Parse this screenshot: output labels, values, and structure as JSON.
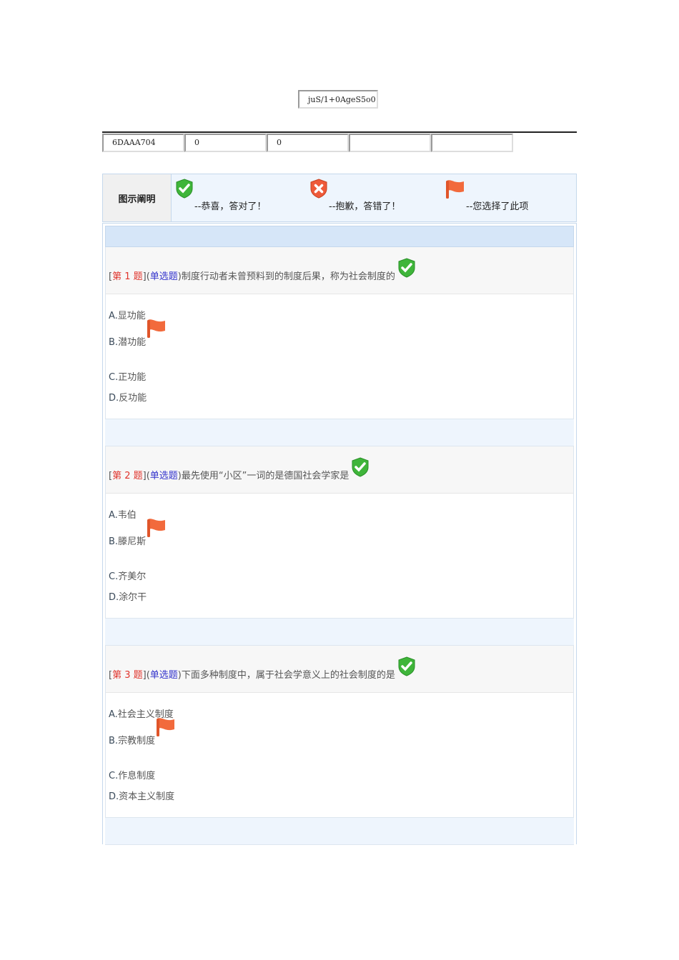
{
  "header": {
    "code": "juS/1+0AgeS5o0",
    "cells": [
      "6DAAA704",
      "0",
      "0",
      "",
      ""
    ]
  },
  "legend": {
    "title": "图示阐明",
    "items": [
      {
        "icon": "check-icon",
        "label": "--恭喜，答对了！"
      },
      {
        "icon": "cross-icon",
        "label": "--抱歉，答错了！"
      },
      {
        "icon": "flag-icon",
        "label": "--您选择了此项"
      }
    ]
  },
  "questions": [
    {
      "no_prefix": "[",
      "no": "第 1 题",
      "no_suffix": "](",
      "type": "单选题",
      "type_suffix": ")",
      "text": " 制度行动者未曾预料到的制度后果，称为社会制度的",
      "result": "correct",
      "selected": 1,
      "options": [
        {
          "letter": "A.",
          "text": "显功能"
        },
        {
          "letter": "B.",
          "text": "潜功能"
        },
        {
          "letter": "C.",
          "text": "正功能"
        },
        {
          "letter": "D.",
          "text": "反功能"
        }
      ]
    },
    {
      "no_prefix": "[",
      "no": "第 2 题",
      "no_suffix": "](",
      "type": "单选题",
      "type_suffix": ")",
      "text": "最先使用“小区”一词的是德国社会学家是",
      "result": "correct",
      "selected": 1,
      "options": [
        {
          "letter": "A.",
          "text": "韦伯"
        },
        {
          "letter": "B.",
          "text": "滕尼斯"
        },
        {
          "letter": "C.",
          "text": "齐美尔"
        },
        {
          "letter": "D.",
          "text": "涂尔干"
        }
      ]
    },
    {
      "no_prefix": "[",
      "no": "第 3 题",
      "no_suffix": "](",
      "type": "单选题",
      "type_suffix": ")",
      "text": "下面多种制度中，属于社会学意义上的社会制度的是",
      "result": "correct",
      "selected": 1,
      "options": [
        {
          "letter": "A.",
          "text": "社会主义制度"
        },
        {
          "letter": "B.",
          "text": "宗教制度"
        },
        {
          "letter": "C.",
          "text": "作息制度"
        },
        {
          "letter": "D.",
          "text": "资本主义制度"
        }
      ]
    }
  ]
}
